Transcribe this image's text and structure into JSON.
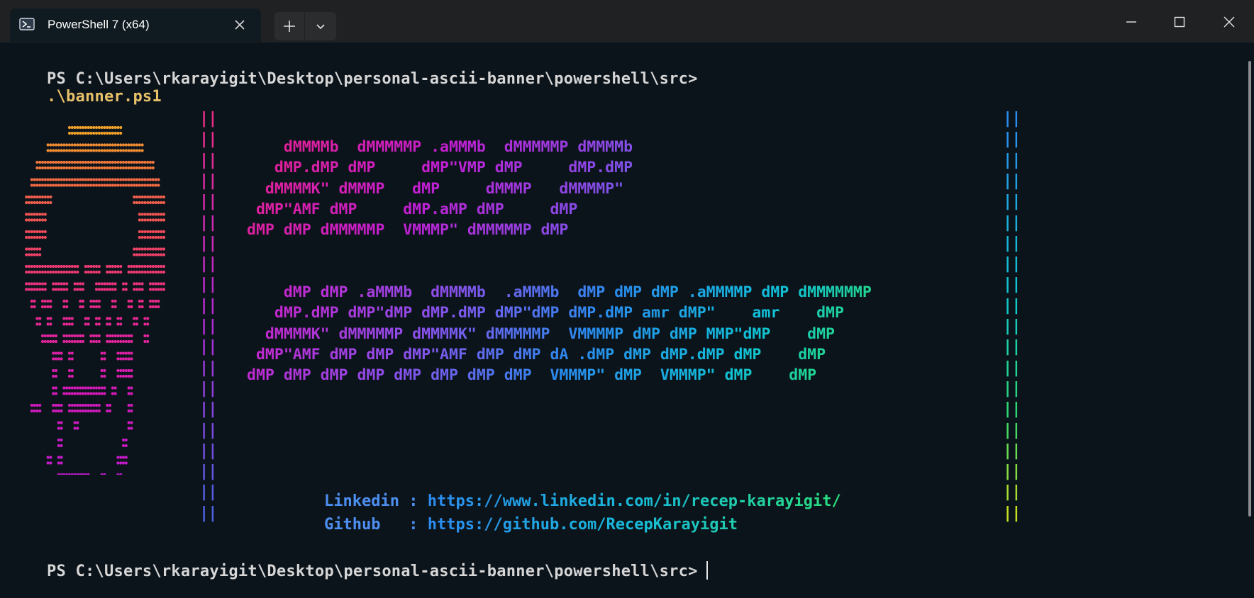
{
  "window": {
    "tab_title": "PowerShell 7 (x64)",
    "icons": {
      "tab": "powershell-icon",
      "close": "close-icon",
      "new_tab": "plus-icon",
      "dropdown": "chevron-down-icon",
      "minimize": "minimize-icon",
      "maximize": "maximize-icon",
      "close_window": "close-icon"
    }
  },
  "terminal": {
    "prompt_path": "PS C:\\Users\\rkarayigit\\Desktop\\personal-ascii-banner\\powershell\\src>",
    "command": ".\\banner.ps1",
    "banner_line1": [
      "    dMMMMb  dMMMMMP .aMMMb  dMMMMMP dMMMMb",
      "   dMP.dMP dMP     dMP\"VMP dMP     dMP.dMP",
      "  dMMMMK\" dMMMP   dMP     dMMMP   dMMMMP\"",
      " dMP\"AMF dMP     dMP.aMP dMP     dMP",
      "dMP dMP dMMMMMP  VMMMP\" dMMMMMP dMP"
    ],
    "banner_line2": [
      "    dMP dMP .aMMMb  dMMMMb  .aMMMb  dMP dMP dMP .aMMMMP dMP dMMMMMMP",
      "   dMP.dMP dMP\"dMP dMP.dMP dMP\"dMP dMP.dMP amr dMP\"    amr    dMP",
      "  dMMMMK\" dMMMMMP dMMMMK\" dMMMMMP  VMMMMP dMP dMP MMP\"dMP    dMP",
      " dMP\"AMF dMP dMP dMP\"AMF dMP dMP dA .dMP dMP dMP.dMP dMP    dMP",
      "dMP dMP dMP dMP dMP dMP dMP dMP  VMMMP\" dMP  VMMMP\" dMP    dMP"
    ],
    "border": "||",
    "links": [
      {
        "label": "Linkedin : ",
        "url": "https://www.linkedin.com/in/recep-karayigit/"
      },
      {
        "label": "Github   : ",
        "url": "https://github.com/RecepKarayigit"
      }
    ]
  }
}
